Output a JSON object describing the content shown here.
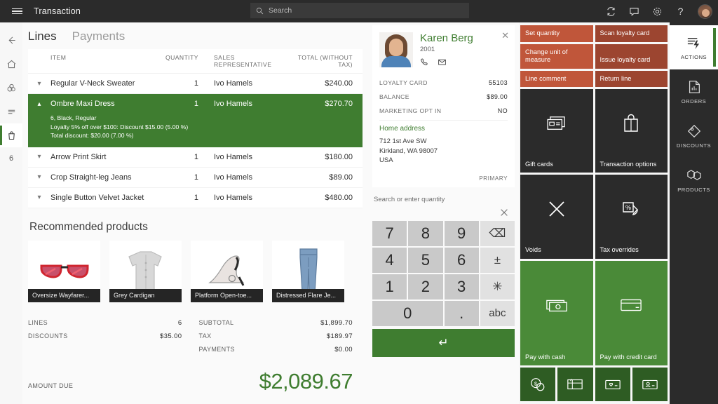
{
  "header": {
    "menu_icon": "hamburger-icon",
    "title": "Transaction",
    "search_placeholder": "Search",
    "icons": [
      "sync-icon",
      "chat-icon",
      "gear-icon",
      "help-icon",
      "avatar"
    ]
  },
  "left_rail": {
    "items": [
      {
        "name": "back",
        "icon": "back-arrow-icon",
        "selected": false
      },
      {
        "name": "home",
        "icon": "home-icon",
        "selected": false
      },
      {
        "name": "products",
        "icon": "products-icon",
        "selected": false
      },
      {
        "name": "list",
        "icon": "list-icon",
        "selected": false
      },
      {
        "name": "cart",
        "icon": "cart-icon",
        "selected": true
      }
    ],
    "badge": "6"
  },
  "tabs": [
    {
      "label": "Lines",
      "active": true
    },
    {
      "label": "Payments",
      "active": false
    }
  ],
  "lines_table": {
    "columns": [
      "ITEM",
      "QUANTITY",
      "SALES REPRESENTATIVE",
      "TOTAL (WITHOUT TAX)"
    ],
    "rows": [
      {
        "item": "Regular V-Neck Sweater",
        "quantity": "1",
        "rep": "Ivo Hamels",
        "total": "$240.00",
        "expanded": false,
        "selected": false
      },
      {
        "item": "Ombre Maxi Dress",
        "quantity": "1",
        "rep": "Ivo Hamels",
        "total": "$270.70",
        "expanded": true,
        "selected": true,
        "details": [
          "6, Black, Regular",
          "Loyalty 5% off over $100: Discount $15.00 (5.00 %)",
          "Total discount: $20.00 (7.00 %)"
        ]
      },
      {
        "item": "Arrow Print Skirt",
        "quantity": "1",
        "rep": "Ivo Hamels",
        "total": "$180.00",
        "expanded": false,
        "selected": false
      },
      {
        "item": "Crop Straight-leg Jeans",
        "quantity": "1",
        "rep": "Ivo Hamels",
        "total": "$89.00",
        "expanded": false,
        "selected": false
      },
      {
        "item": "Single Button Velvet Jacket",
        "quantity": "1",
        "rep": "Ivo Hamels",
        "total": "$480.00",
        "expanded": false,
        "selected": false
      }
    ]
  },
  "recommended": {
    "title": "Recommended products",
    "products": [
      {
        "label": "Oversize Wayfarer...",
        "image": "sunglasses"
      },
      {
        "label": "Grey Cardigan",
        "image": "cardigan"
      },
      {
        "label": "Platform Open-toe...",
        "image": "high-heel"
      },
      {
        "label": "Distressed Flare Je...",
        "image": "jeans"
      }
    ]
  },
  "totals": {
    "left": [
      {
        "label": "LINES",
        "value": "6"
      },
      {
        "label": "DISCOUNTS",
        "value": "$35.00"
      }
    ],
    "right": [
      {
        "label": "SUBTOTAL",
        "value": "$1,899.70"
      },
      {
        "label": "TAX",
        "value": "$189.97"
      },
      {
        "label": "PAYMENTS",
        "value": "$0.00"
      }
    ],
    "amount_due_label": "AMOUNT DUE",
    "amount_due_value": "$2,089.67"
  },
  "customer": {
    "name": "Karen Berg",
    "id": "2001",
    "phone_icon": "phone-icon",
    "email_icon": "envelope-icon",
    "close_icon": "close-icon",
    "fields": [
      {
        "label": "LOYALTY CARD",
        "value": "55103"
      },
      {
        "label": "BALANCE",
        "value": "$89.00"
      },
      {
        "label": "MARKETING OPT IN",
        "value": "NO"
      }
    ],
    "address_title": "Home address",
    "address_lines": [
      "712 1st Ave SW",
      "Kirkland, WA 98007",
      "USA"
    ],
    "address_tag": "PRIMARY"
  },
  "keypad": {
    "label": "Search or enter quantity",
    "clear_icon": "close-icon",
    "keys": [
      {
        "label": "7",
        "type": "num"
      },
      {
        "label": "8",
        "type": "num"
      },
      {
        "label": "9",
        "type": "num"
      },
      {
        "label": "⌫",
        "type": "fn",
        "name": "backspace-icon"
      },
      {
        "label": "4",
        "type": "num"
      },
      {
        "label": "5",
        "type": "num"
      },
      {
        "label": "6",
        "type": "num"
      },
      {
        "label": "±",
        "type": "fn",
        "name": "plus-minus-key"
      },
      {
        "label": "1",
        "type": "num"
      },
      {
        "label": "2",
        "type": "num"
      },
      {
        "label": "3",
        "type": "num"
      },
      {
        "label": "✳",
        "type": "fn",
        "name": "asterisk-key"
      },
      {
        "label": "0",
        "type": "num",
        "span": true
      },
      {
        "label": ".",
        "type": "num"
      },
      {
        "label": "abc",
        "type": "fn",
        "name": "abc-key"
      }
    ],
    "enter_label": "↵"
  },
  "tiles": {
    "rows": [
      [
        {
          "label": "Set quantity",
          "style": "t-orange",
          "icon": null
        },
        {
          "label": "Scan loyalty card",
          "style": "t-orange-dk",
          "icon": null
        }
      ],
      [
        {
          "label": "Change unit of measure",
          "style": "t-orange",
          "icon": null
        },
        {
          "label": "Issue loyalty card",
          "style": "t-orange-dk",
          "icon": null
        }
      ],
      [
        {
          "label": "Line comment",
          "style": "t-orange",
          "icon": null
        },
        {
          "label": "Return line",
          "style": "t-orange-dk",
          "icon": null
        }
      ],
      [
        {
          "label": "Gift cards",
          "style": "t-dark",
          "icon": "gift-card-icon"
        },
        {
          "label": "Transaction options",
          "style": "t-dark",
          "icon": "shopping-bag-icon"
        }
      ],
      [
        {
          "label": "Voids",
          "style": "t-dark",
          "icon": "close-x-icon"
        },
        {
          "label": "Tax overrides",
          "style": "t-dark",
          "icon": "tax-override-icon"
        }
      ],
      [
        {
          "label": "Pay with cash",
          "style": "t-green",
          "icon": "cash-icon"
        },
        {
          "label": "Pay with credit card",
          "style": "t-green",
          "icon": "credit-card-icon"
        }
      ]
    ],
    "mini_tiles": [
      {
        "name": "pay-currency-button",
        "icon": "coins-icon"
      },
      {
        "name": "pay-gift-card-button",
        "icon": "gift-card-icon"
      },
      {
        "name": "pay-loyalty-button",
        "icon": "loyalty-card-icon"
      },
      {
        "name": "pay-customer-account-button",
        "icon": "customer-account-icon"
      }
    ]
  },
  "right_rail": {
    "items": [
      {
        "label": "ACTIONS",
        "icon": "actions-icon",
        "selected": true
      },
      {
        "label": "ORDERS",
        "icon": "orders-icon",
        "selected": false
      },
      {
        "label": "DISCOUNTS",
        "icon": "discounts-icon",
        "selected": false
      },
      {
        "label": "PRODUCTS",
        "icon": "products-cube-icon",
        "selected": false
      }
    ]
  },
  "colors": {
    "accent_green": "#3f7d30",
    "tile_orange": "#c0563a",
    "tile_orange_dark": "#9c4530",
    "tile_dark": "#2b2b2b",
    "tile_green": "#4a8a38",
    "tile_green_dark": "#2e5c23"
  }
}
